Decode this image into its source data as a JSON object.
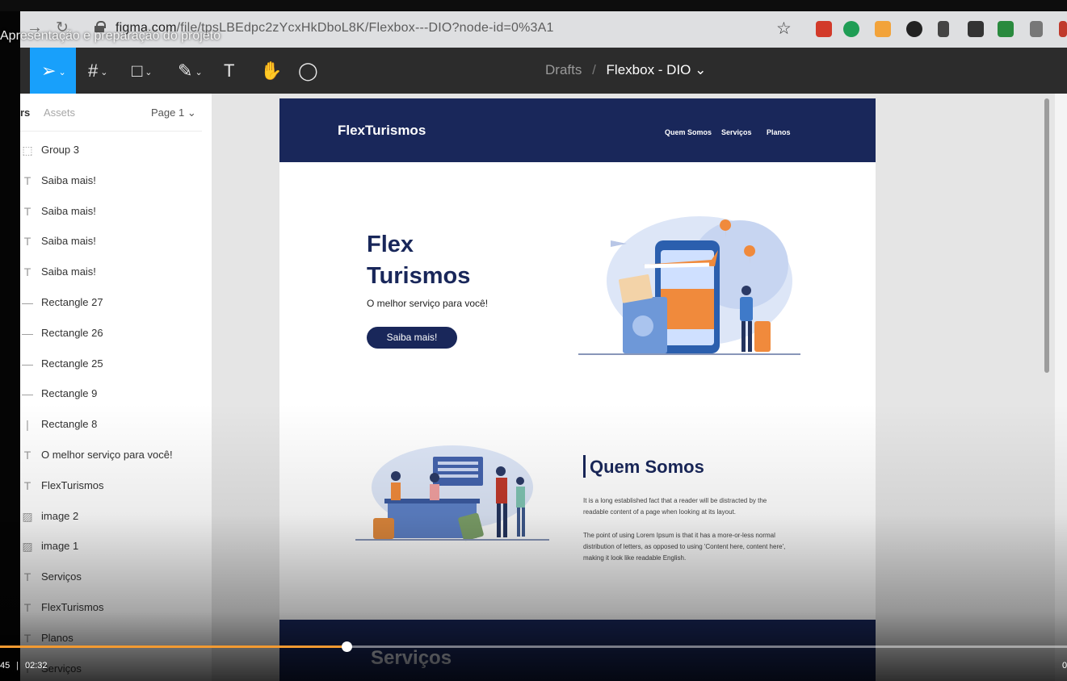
{
  "video": {
    "title": "Apresentação e preparação do projeto",
    "current_time": "45",
    "time_separator": "|",
    "duration": "02:32",
    "right_time": "0",
    "progress_percent": 32.5,
    "accent": "#f29a31"
  },
  "browser": {
    "url_host": "figma.com",
    "url_path": "/file/tpsLBEdpc2zYcxHkDboL8K/Flexbox---DIO?node-id=0%3A1"
  },
  "figma": {
    "accent": "#18a0fb",
    "breadcrumb": {
      "folder": "Drafts",
      "separator": "/",
      "file": "Flexbox - DIO ⌄"
    },
    "layers_tab": "rs",
    "assets_tab": "Assets",
    "page_label": "Page 1 ⌄",
    "layers": [
      {
        "icon": "group-icon",
        "glyph": "⬚",
        "name": "Group 3"
      },
      {
        "icon": "text-icon",
        "glyph": "T",
        "name": "Saiba mais!"
      },
      {
        "icon": "text-icon",
        "glyph": "T",
        "name": "Saiba mais!"
      },
      {
        "icon": "text-icon",
        "glyph": "T",
        "name": "Saiba mais!"
      },
      {
        "icon": "text-icon",
        "glyph": "T",
        "name": "Saiba mais!"
      },
      {
        "icon": "rectangle-icon",
        "glyph": "—",
        "name": "Rectangle 27"
      },
      {
        "icon": "rectangle-icon",
        "glyph": "—",
        "name": "Rectangle 26"
      },
      {
        "icon": "rectangle-icon",
        "glyph": "—",
        "name": "Rectangle 25"
      },
      {
        "icon": "rectangle-icon",
        "glyph": "—",
        "name": "Rectangle 9"
      },
      {
        "icon": "rectangle-icon",
        "glyph": "|",
        "name": "Rectangle 8"
      },
      {
        "icon": "text-icon",
        "glyph": "T",
        "name": "O melhor serviço para você!"
      },
      {
        "icon": "text-icon",
        "glyph": "T",
        "name": "FlexTurismos"
      },
      {
        "icon": "image-icon",
        "glyph": "▨",
        "name": "image 2"
      },
      {
        "icon": "image-icon",
        "glyph": "▨",
        "name": "image 1"
      },
      {
        "icon": "text-icon",
        "glyph": "T",
        "name": "Serviços"
      },
      {
        "icon": "text-icon",
        "glyph": "T",
        "name": "FlexTurismos"
      },
      {
        "icon": "text-icon",
        "glyph": "T",
        "name": "Planos"
      },
      {
        "icon": "text-icon",
        "glyph": "T",
        "name": "Serviços"
      }
    ]
  },
  "design": {
    "brand_color": "#19275a",
    "logo": "FlexTurismos",
    "nav": [
      "Quem Somos",
      "Serviços",
      "Planos"
    ],
    "hero_title_1": "Flex",
    "hero_title_2": "Turismos",
    "hero_subtitle": "O melhor serviço para você!",
    "hero_button": "Saiba mais!",
    "about_title": "Quem Somos",
    "about_p1_l1": "It is a long established fact that a reader will be distracted by the",
    "about_p1_l2": "readable content of a page when looking at its layout.",
    "about_p2_l1": "The point of using Lorem Ipsum is that it has a more-or-less normal",
    "about_p2_l2": "distribution of letters, as opposed to using 'Content here, content here',",
    "about_p2_l3": "making it look like readable English.",
    "services_title": "Serviços"
  }
}
